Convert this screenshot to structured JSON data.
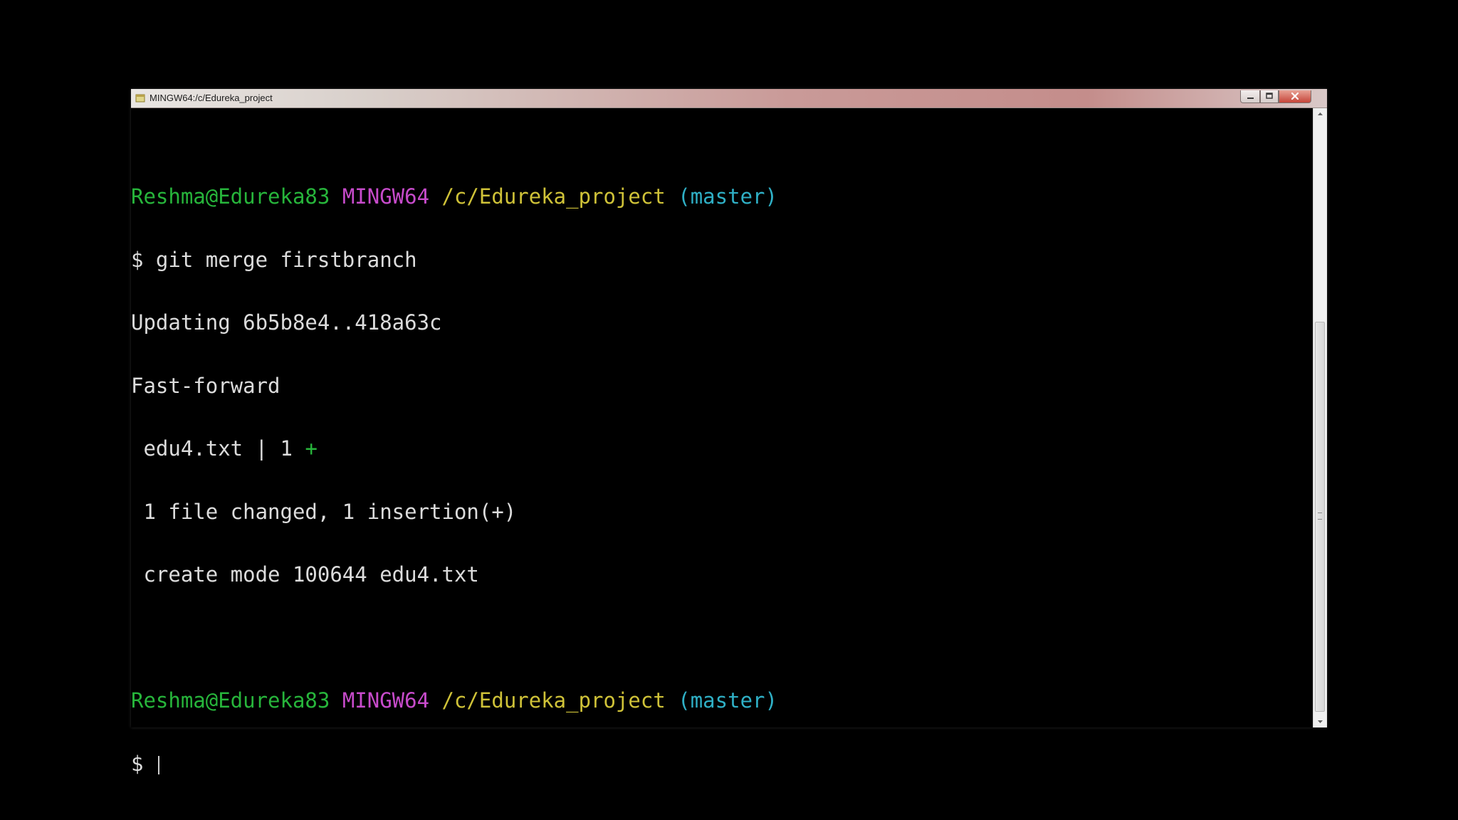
{
  "window": {
    "title": "MINGW64:/c/Edureka_project",
    "icon": "git-bash-icon",
    "controls": [
      "minimize",
      "maximize",
      "close"
    ]
  },
  "colors": {
    "user": "#27b53b",
    "host": "#c74bcb",
    "path": "#cfc238",
    "branch": "#2fb0c6",
    "text": "#dcdcdc",
    "background": "#000000"
  },
  "terminal": {
    "prompt1": {
      "user": "Reshma@Edureka83",
      "host": "MINGW64",
      "path": "/c/Edureka_project",
      "branch": "(master)"
    },
    "command": "$ git merge firstbranch",
    "output": {
      "updating": "Updating 6b5b8e4..418a63c",
      "fast_forward": "Fast-forward",
      "file_stat_name": " edu4.txt | 1 ",
      "file_stat_plus": "+",
      "summary": " 1 file changed, 1 insertion(+)",
      "create_mode": " create mode 100644 edu4.txt"
    },
    "prompt2": {
      "user": "Reshma@Edureka83",
      "host": "MINGW64",
      "path": "/c/Edureka_project",
      "branch": "(master)"
    },
    "input_prompt": "$ "
  }
}
